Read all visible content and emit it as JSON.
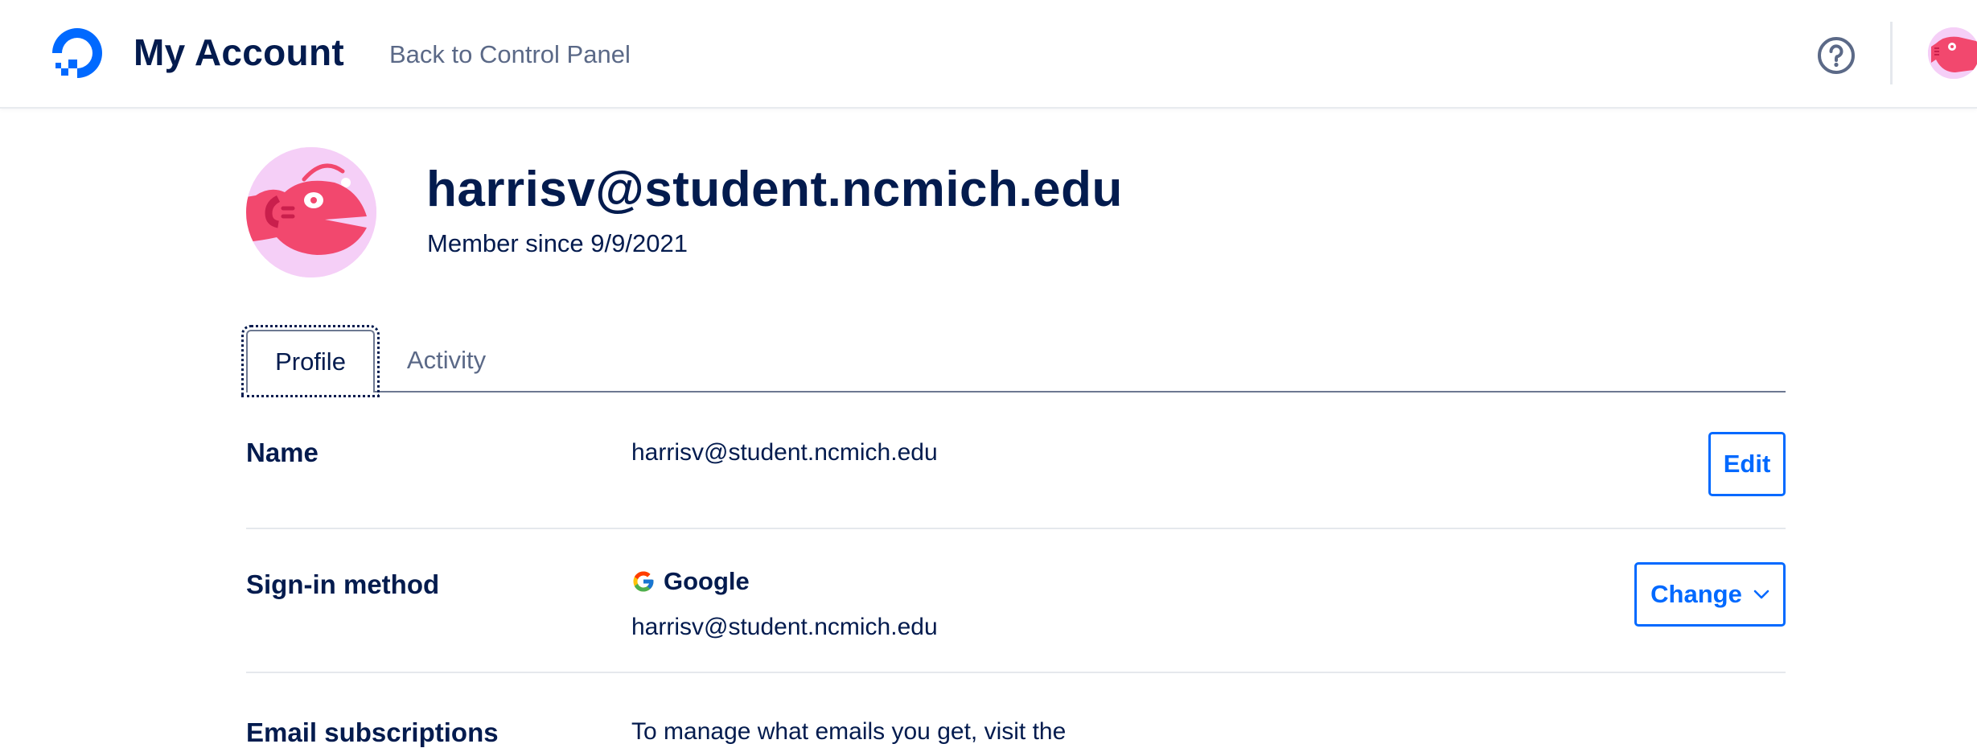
{
  "header": {
    "title": "My Account",
    "back_link": "Back to Control Panel",
    "help_icon": "question-circle-icon",
    "avatar_icon": "anglerfish-avatar-icon"
  },
  "profile": {
    "email": "harrisv@student.ncmich.edu",
    "member_since": "Member since 9/9/2021"
  },
  "tabs": [
    {
      "label": "Profile",
      "active": true
    },
    {
      "label": "Activity",
      "active": false
    }
  ],
  "rows": {
    "name": {
      "label": "Name",
      "value": "harrisv@student.ncmich.edu",
      "button": "Edit"
    },
    "signin": {
      "label": "Sign-in method",
      "provider": "Google",
      "email": "harrisv@student.ncmich.edu",
      "button": "Change"
    },
    "email_subscriptions": {
      "label": "Email subscriptions",
      "value": "To manage what emails you get, visit the"
    }
  },
  "colors": {
    "brand": "#0069ff",
    "text": "#031b4e",
    "muted": "#5b6987",
    "avatar_bg": "#f5cff7",
    "avatar_fish": "#f2486e"
  }
}
